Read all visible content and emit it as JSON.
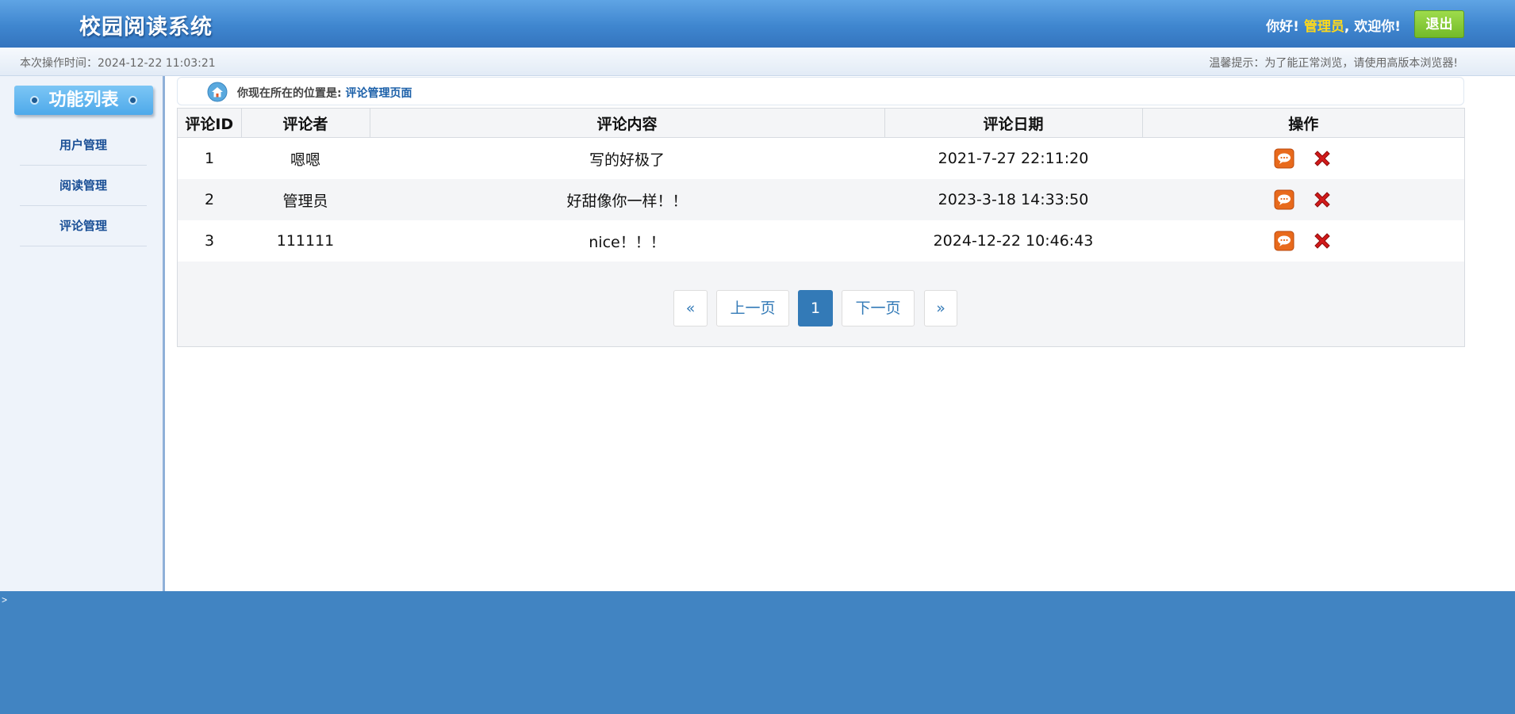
{
  "header": {
    "app_title": "校园阅读系统",
    "greeting_prefix": "你好!",
    "username": "管理员",
    "greeting_suffix": ", 欢迎你!",
    "logout_label": "退出"
  },
  "infobar": {
    "operation_time": "本次操作时间：2024-12-22 11:03:21",
    "tip": "温馨提示：为了能正常浏览，请使用高版本浏览器!"
  },
  "sidebar": {
    "title": "功能列表",
    "items": [
      {
        "label": "用户管理"
      },
      {
        "label": "阅读管理"
      },
      {
        "label": "评论管理"
      }
    ]
  },
  "breadcrumb": {
    "prefix": "你现在所在的位置是: ",
    "current": "评论管理页面"
  },
  "table": {
    "columns": [
      "评论ID",
      "评论者",
      "评论内容",
      "评论日期",
      "操作"
    ],
    "rows": [
      {
        "id": "1",
        "author": "嗯嗯",
        "content": "写的好极了",
        "date": "2021-7-27 22:11:20"
      },
      {
        "id": "2",
        "author": "管理员",
        "content": "好甜像你一样！！",
        "date": "2023-3-18 14:33:50"
      },
      {
        "id": "3",
        "author": "111111",
        "content": "nice！！！",
        "date": "2024-12-22 10:46:43"
      }
    ]
  },
  "pagination": {
    "first": "«",
    "prev": "上一页",
    "current": "1",
    "next": "下一页",
    "last": "»"
  },
  "footer": {
    "marker": ">"
  },
  "icons": {
    "home": "home-icon",
    "comment": "comment-icon",
    "delete": "delete-icon"
  },
  "colors": {
    "header_blue": "#3f86cf",
    "logout_green": "#73bb28",
    "username_yellow": "#ffd91a",
    "link_blue": "#1a5fa8",
    "pager_active": "#337ab7",
    "footer_blue": "#4184c2",
    "delete_red": "#d21a1a",
    "comment_orange": "#e86a1c"
  }
}
